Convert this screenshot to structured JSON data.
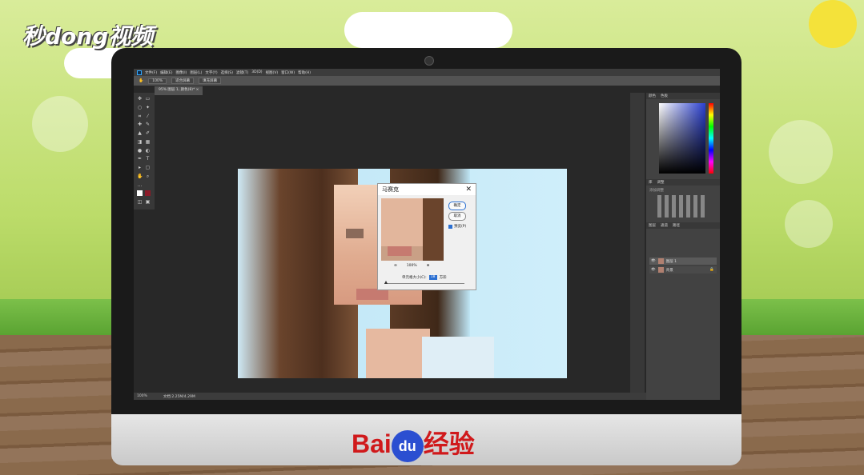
{
  "watermark_top": "秒dong视频",
  "brand_bottom": {
    "prefix": "Bai",
    "badge": "du",
    "suffix": "经验"
  },
  "menubar": [
    "文件(F)",
    "编辑(E)",
    "图像(I)",
    "图层(L)",
    "文字(Y)",
    "选择(S)",
    "滤镜(T)",
    "3D(D)",
    "视图(V)",
    "窗口(W)",
    "帮助(H)"
  ],
  "options": {
    "zoom": "100%",
    "fit_screen": "适合屏幕",
    "fill_screen": "填充屏幕"
  },
  "document_tab": "95% 图层 1, 颜色(8)* ×",
  "status": {
    "zoom": "100%",
    "doc": "文档:2.25M/4.29M"
  },
  "panels": {
    "color_tabs": [
      "颜色",
      "色板"
    ],
    "adjust_tabs": [
      "库",
      "调整"
    ],
    "adjust_label": "添加调整",
    "layer_tabs": [
      "图层",
      "通道",
      "路径"
    ],
    "layers": [
      {
        "name": "图层 1"
      },
      {
        "name": "背景"
      }
    ]
  },
  "dialog": {
    "title": "马赛克",
    "ok": "确定",
    "cancel": "取消",
    "preview_label": "预览(P)",
    "zoom_pct": "100%",
    "cell_label": "单元格大小(C):",
    "cell_value": "18",
    "cell_unit": "方形"
  },
  "colors": {
    "accent": "#2b6fd1",
    "baidu_red": "#d0191b",
    "baidu_blue": "#2b4fd1"
  }
}
